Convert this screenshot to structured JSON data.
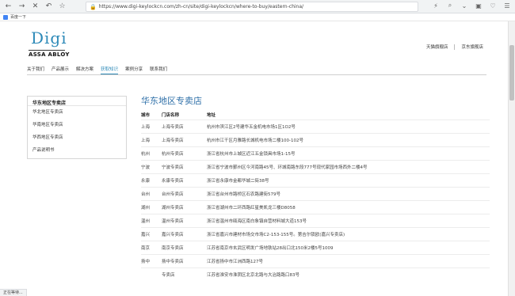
{
  "browser": {
    "url": "https://www.digi-keylockcn.com/zh-cn/site/digi-keylockcn/where-to-buy/eastern-china/",
    "bookmark_label": "百度一下",
    "status_text": "正在等待..."
  },
  "site": {
    "logo_text": "Digi",
    "brand_text": "ASSA ABLOY",
    "store_links": [
      "天猫旗舰店",
      "京东旗舰店"
    ],
    "nav": [
      {
        "label": "关于我们",
        "active": false
      },
      {
        "label": "产品展示",
        "active": false
      },
      {
        "label": "解决方案",
        "active": false
      },
      {
        "label": "获取知识",
        "active": true
      },
      {
        "label": "案例分享",
        "active": false
      },
      {
        "label": "联系我们",
        "active": false
      }
    ]
  },
  "sidebar": {
    "heading": "华东地区专卖店",
    "items": [
      "华北地区专卖店",
      "华南地区专卖店",
      "华西地区专卖店",
      "产品说明书"
    ]
  },
  "main": {
    "title": "华东地区专卖店",
    "columns": [
      "城市",
      "门店名称",
      "地址"
    ],
    "rows": [
      {
        "city": "上海",
        "name": "上海专卖店",
        "address": "杭州市滨江区2号建华五金机电市场1区1O2号"
      },
      {
        "city": "上海",
        "name": "上海专卖店",
        "address": "杭州市江干区月雅路长城机电市场二楼100-102号"
      },
      {
        "city": "杭州",
        "name": "杭州专卖店",
        "address": "浙江省杭州市上城区近江五金锁具市场1-15号"
      },
      {
        "city": "宁波",
        "name": "宁波专卖店",
        "address": "浙江省宁波市鄞州区今河南路45号、环城南路东段777号现代家园市场西外二楼4号"
      },
      {
        "city": "永康",
        "name": "永康专卖店",
        "address": "浙江省永康市金都华城二街38号"
      },
      {
        "city": "台州",
        "name": "台州专卖店",
        "address": "浙江省台州市路桥区石农路建街579号"
      },
      {
        "city": "湖州",
        "name": "湖州专卖店",
        "address": "浙江省湖州市二环西路红星美凯龙三楼D8058"
      },
      {
        "city": "温州",
        "name": "温州专卖店",
        "address": "浙江省温州市瓯海区南白象镇自营材料城大道153号"
      },
      {
        "city": "嘉兴",
        "name": "嘉兴专卖店",
        "address": "浙江省嘉兴市建材市场交市场C2-153-155号。第吉尔锁欧(嘉兴专卖店)"
      },
      {
        "city": "南京",
        "name": "南京专卖店",
        "address": "江苏省南京市玄武区明发广场地铁站28出口北150米2楼5号1009"
      },
      {
        "city": "扬中",
        "name": "扬中专卖店",
        "address": "江苏省扬中市江洲西路127号"
      },
      {
        "city": "",
        "name": "专卖店",
        "address": "江苏省淮安市淮阴区北京北路与大治路路口83号"
      }
    ]
  }
}
